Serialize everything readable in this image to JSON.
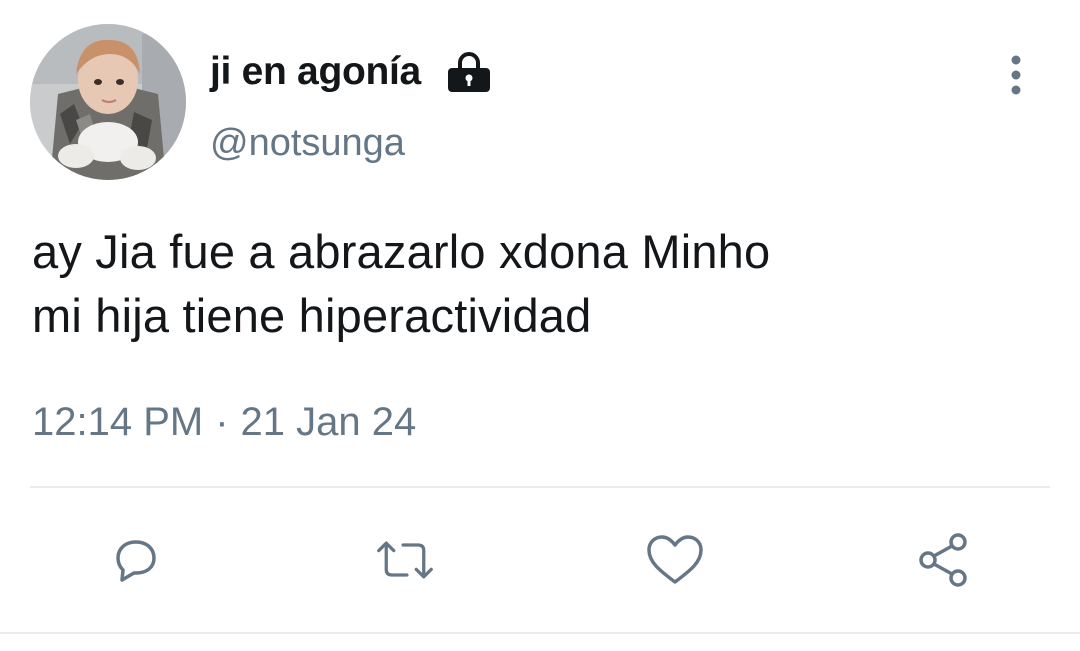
{
  "user": {
    "display_name": "ji en agonía",
    "handle": "@notsunga",
    "avatar_icon": "profile-photo",
    "protected_icon": "lock-icon"
  },
  "tweet": {
    "text_lines": [
      "ay Jia fue a abrazarlo xdona Minho",
      "mi hija tiene hiperactividad"
    ],
    "time": "12:14 PM",
    "separator": "·",
    "date": "21 Jan 24"
  },
  "actions": {
    "reply_icon": "reply-icon",
    "retweet_icon": "retweet-icon",
    "like_icon": "heart-icon",
    "share_icon": "share-icon",
    "more_icon": "more-vertical-icon"
  },
  "colors": {
    "text": "#14171a",
    "secondary": "#657786",
    "divider": "#e6ecf0"
  }
}
